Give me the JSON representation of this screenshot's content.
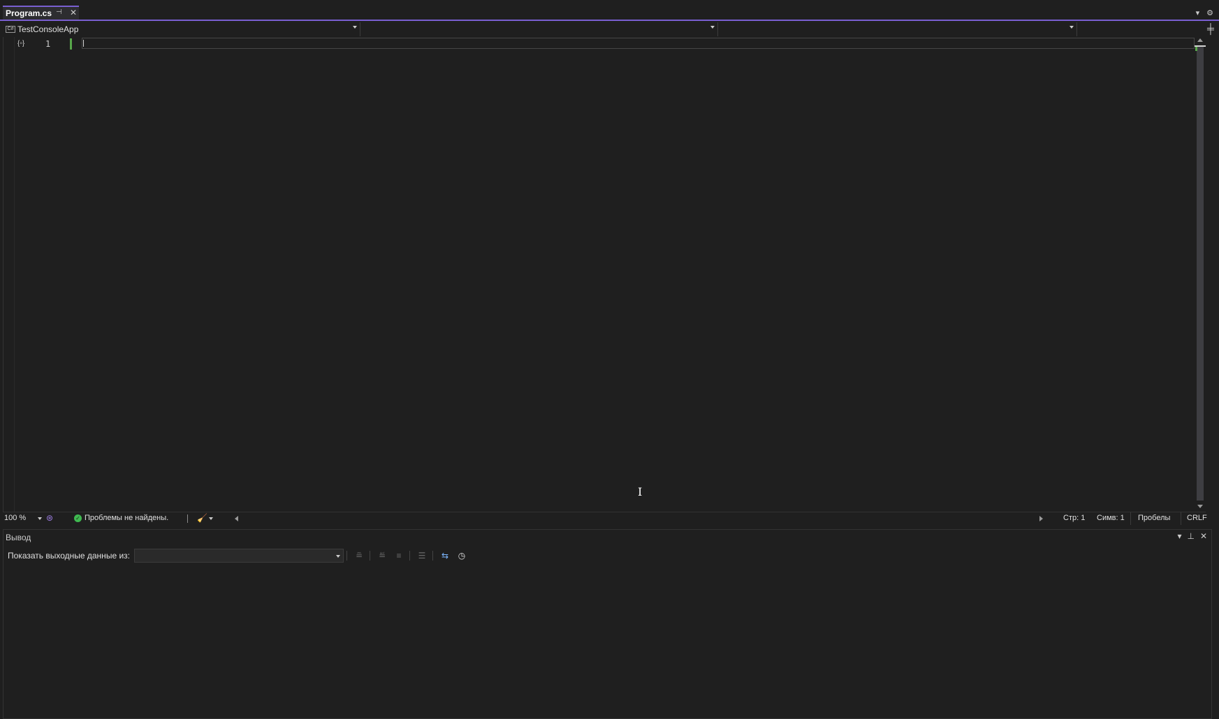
{
  "tab": {
    "title": "Program.cs",
    "pin_icon": "pin-icon",
    "close_icon": "close-icon"
  },
  "tabstrip": {
    "dropdown_icon": "chevron-down-icon",
    "settings_icon": "gear-icon"
  },
  "navbar": {
    "project_icon_text": "C#",
    "project": "TestConsoleApp",
    "type": "",
    "member": ""
  },
  "editor": {
    "line_numbers": [
      "1"
    ],
    "namespace_icon": "namespace-icon"
  },
  "status": {
    "zoom": "100 %",
    "issues": "Проблемы не найдены.",
    "line": "Стр: 1",
    "column": "Симв: 1",
    "indent": "Пробелы",
    "eol": "CRLF"
  },
  "output": {
    "title": "Вывод",
    "show_output_label": "Показать выходные данные из:",
    "source_value": ""
  },
  "colors": {
    "accent": "#7a5fd1",
    "background": "#1f1f1f",
    "change_bar": "#57a64a",
    "ok": "#3fb950"
  }
}
